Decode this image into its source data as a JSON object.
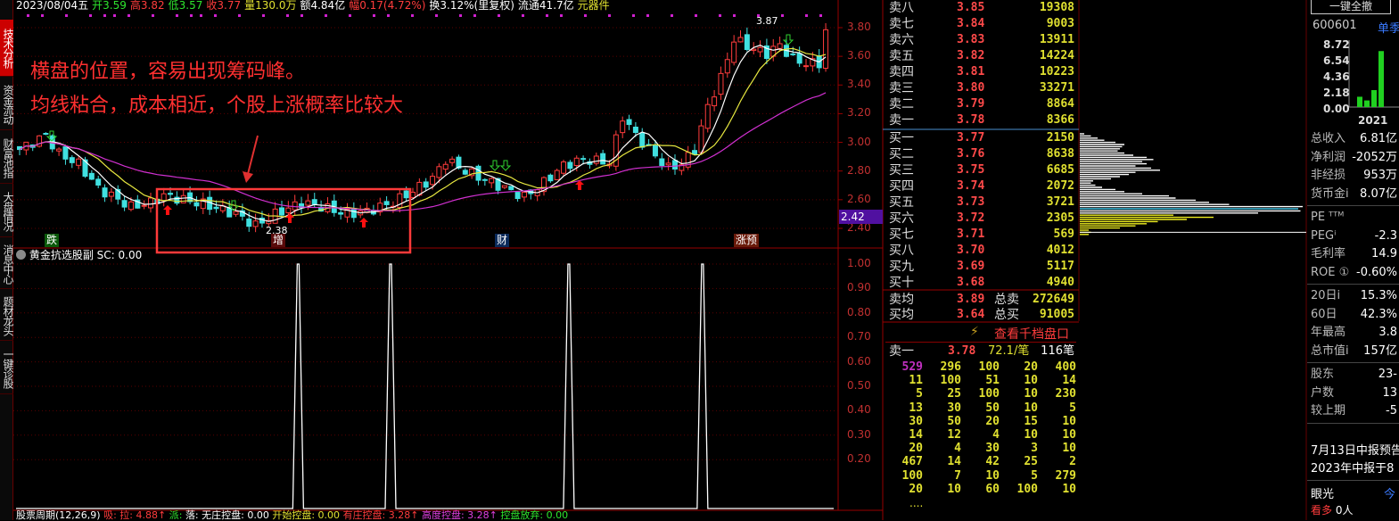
{
  "sidebar": {
    "tabs": [
      "技术分析",
      "资金流动",
      "财富池指",
      "大盘情况",
      "消息中心",
      "题材龙头",
      "一键诊股"
    ]
  },
  "infobar": {
    "date": "2023/08/04五",
    "open": "开3.59",
    "high": "高3.82",
    "low": "低3.57",
    "close": "收3.77",
    "volume": "量130.0万",
    "amount": "额4.84亿",
    "change": "幅0.17(4.72%)",
    "turnover": "换3.12%(里复权)",
    "float": "流通41.7亿",
    "sector": "元器件"
  },
  "chart": {
    "price_axis": [
      "3.80",
      "3.60",
      "3.40",
      "3.20",
      "3.00",
      "2.80",
      "2.60",
      "2.40"
    ],
    "current_price_tag": "2.42",
    "high_label": "3.87",
    "low_label": "2.38",
    "price_anchors": [
      [
        0,
        2.95
      ],
      [
        4,
        3.05
      ],
      [
        6,
        2.92
      ],
      [
        9,
        2.85
      ],
      [
        12,
        2.68
      ],
      [
        17,
        2.55
      ],
      [
        20,
        2.58
      ],
      [
        22,
        2.63
      ],
      [
        28,
        2.57
      ],
      [
        33,
        2.5
      ],
      [
        36,
        2.42
      ],
      [
        39,
        2.5
      ],
      [
        43,
        2.58
      ],
      [
        46,
        2.55
      ],
      [
        50,
        2.5
      ],
      [
        53,
        2.52
      ],
      [
        57,
        2.58
      ],
      [
        60,
        2.66
      ],
      [
        63,
        2.75
      ],
      [
        65,
        2.88
      ],
      [
        68,
        2.8
      ],
      [
        71,
        2.74
      ],
      [
        74,
        2.68
      ],
      [
        77,
        2.62
      ],
      [
        80,
        2.72
      ],
      [
        83,
        2.84
      ],
      [
        86,
        2.88
      ],
      [
        90,
        2.86
      ],
      [
        92,
        3.18
      ],
      [
        94,
        3.05
      ],
      [
        96,
        2.95
      ],
      [
        99,
        2.82
      ],
      [
        101,
        2.85
      ],
      [
        103,
        2.95
      ],
      [
        105,
        3.25
      ],
      [
        107,
        3.45
      ],
      [
        109,
        3.72
      ],
      [
        112,
        3.65
      ],
      [
        114,
        3.62
      ],
      [
        116,
        3.68
      ],
      [
        118,
        3.58
      ],
      [
        120,
        3.55
      ],
      [
        122,
        3.55
      ],
      [
        123,
        3.78
      ]
    ],
    "tags": {
      "die": "跌",
      "zeng": "增",
      "cai": "财",
      "zhangyu": "涨预"
    },
    "annotation_line1": "横盘的位置，容易出现筹码峰。",
    "annotation_line2": "均线粘合，成本相近，个股上涨概率比较大",
    "colors": {
      "up": "#ff3c3c",
      "down": "#40e0e0",
      "ma5": "#ffffff",
      "ma10": "#e8e840",
      "ma30": "#d030d0"
    }
  },
  "indicator": {
    "title": "黄金抗选股副",
    "sc": "SC: 0.00",
    "axis": [
      "1.00",
      "0.90",
      "0.80",
      "0.70",
      "0.60",
      "0.50",
      "0.40",
      "0.30",
      "0.20"
    ],
    "signal_bars": [
      42.5,
      56.6,
      83.8,
      104.2
    ]
  },
  "statusbar": {
    "name": "股票周期(12,26,9)",
    "xi": "吸:",
    "la": "拉: 4.88↑",
    "pai": "派:",
    "luo": "落:",
    "wuzhuang": "无庄控盘: 0.00",
    "kaishi": "开始控盘: 0.00",
    "youzhuang": "有庄控盘: 3.28↑",
    "gaodu": "高度控盘: 3.28↑",
    "fangqi": "控盘放弃: 0.00"
  },
  "orderbook": {
    "asks": [
      [
        "卖八",
        "3.85",
        "19308"
      ],
      [
        "卖七",
        "3.84",
        "9003"
      ],
      [
        "卖六",
        "3.83",
        "13911"
      ],
      [
        "卖五",
        "3.82",
        "14224"
      ],
      [
        "卖四",
        "3.81",
        "10223"
      ],
      [
        "卖三",
        "3.80",
        "33271"
      ],
      [
        "卖二",
        "3.79",
        "8864"
      ],
      [
        "卖一",
        "3.78",
        "8366"
      ]
    ],
    "bids": [
      [
        "买一",
        "3.77",
        "2150"
      ],
      [
        "买二",
        "3.76",
        "8638"
      ],
      [
        "买三",
        "3.75",
        "6685"
      ],
      [
        "买四",
        "3.74",
        "2072"
      ],
      [
        "买五",
        "3.73",
        "3721"
      ],
      [
        "买六",
        "3.72",
        "2305"
      ],
      [
        "买七",
        "3.71",
        "569"
      ],
      [
        "买八",
        "3.70",
        "4012"
      ],
      [
        "买九",
        "3.69",
        "5117"
      ],
      [
        "买十",
        "3.68",
        "4940"
      ]
    ],
    "avg_ask": [
      "卖均",
      "3.89",
      "总卖",
      "272649"
    ],
    "avg_bid": [
      "买均",
      "3.64",
      "总买",
      "91005"
    ],
    "depth_button": "查看千档盘口",
    "level1": {
      "label": "卖一",
      "price": "3.78",
      "per_trade": "72.1/笔",
      "count": "116笔"
    },
    "queue": [
      [
        "529",
        "296",
        "100",
        "20",
        "400"
      ],
      [
        "11",
        "100",
        "51",
        "10",
        "14"
      ],
      [
        "5",
        "25",
        "100",
        "10",
        "230"
      ],
      [
        "13",
        "30",
        "50",
        "10",
        "5"
      ],
      [
        "30",
        "50",
        "20",
        "15",
        "10"
      ],
      [
        "14",
        "12",
        "4",
        "10",
        "10"
      ],
      [
        "20",
        "4",
        "30",
        "3",
        "10"
      ],
      [
        "467",
        "14",
        "42",
        "25",
        "2"
      ],
      [
        "100",
        "7",
        "10",
        "5",
        "279"
      ],
      [
        "20",
        "10",
        "60",
        "100",
        "10"
      ]
    ],
    "more": "...."
  },
  "chip_profile": [
    0.02,
    0.05,
    0.08,
    0.11,
    0.16,
    0.2,
    0.19,
    0.18,
    0.17,
    0.2,
    0.24,
    0.3,
    0.33,
    0.28,
    0.3,
    0.25,
    0.32,
    0.36,
    0.25,
    0.22,
    0.18,
    0.14,
    0.06,
    0.05,
    0.07,
    0.1,
    0.16,
    0.2,
    0.28,
    0.4,
    0.43,
    0.52,
    0.58,
    0.67,
    1.0,
    0.98,
    0.99,
    0.8,
    0.42,
    0.6,
    0.48,
    0.35,
    0.3,
    0.25,
    0.18,
    0.04,
    0.05,
    0.04
  ],
  "chip_current_index": 46,
  "right_panel": {
    "cancel_all": "一键全撤",
    "code": "600601",
    "period": "单季",
    "mini_axis": [
      "8.72",
      "6.54",
      "4.36",
      "2.18",
      "0.00"
    ],
    "mini_year": "2021",
    "mini_values": [
      1.4,
      0.9,
      2.3,
      7.6
    ],
    "group1": [
      [
        "总收入",
        "6.81亿"
      ],
      [
        "净利润",
        "-2052万"
      ],
      [
        "非经损",
        "953万"
      ],
      [
        "货币金i",
        "8.07亿"
      ]
    ],
    "group2": [
      [
        "PE ᵀᵀᴹ",
        ""
      ],
      [
        "PEGⁱ",
        "-2.3"
      ],
      [
        "毛利率",
        "14.9"
      ],
      [
        "ROE ①",
        "-0.60%"
      ]
    ],
    "group3": [
      [
        "20日i",
        "15.3%"
      ],
      [
        "60日",
        "42.3%"
      ],
      [
        "年最高",
        "3.8"
      ],
      [
        "总市值i",
        "157亿"
      ]
    ],
    "group4": [
      [
        "股东",
        "23-"
      ],
      [
        "户数",
        "13"
      ],
      [
        "较上期",
        "-5"
      ]
    ],
    "notice1": "7月13日中报预告",
    "notice2": "2023年中报于8",
    "eye": "眼光",
    "today": "今",
    "bullish": "看多",
    "bullish_count": "0人"
  }
}
